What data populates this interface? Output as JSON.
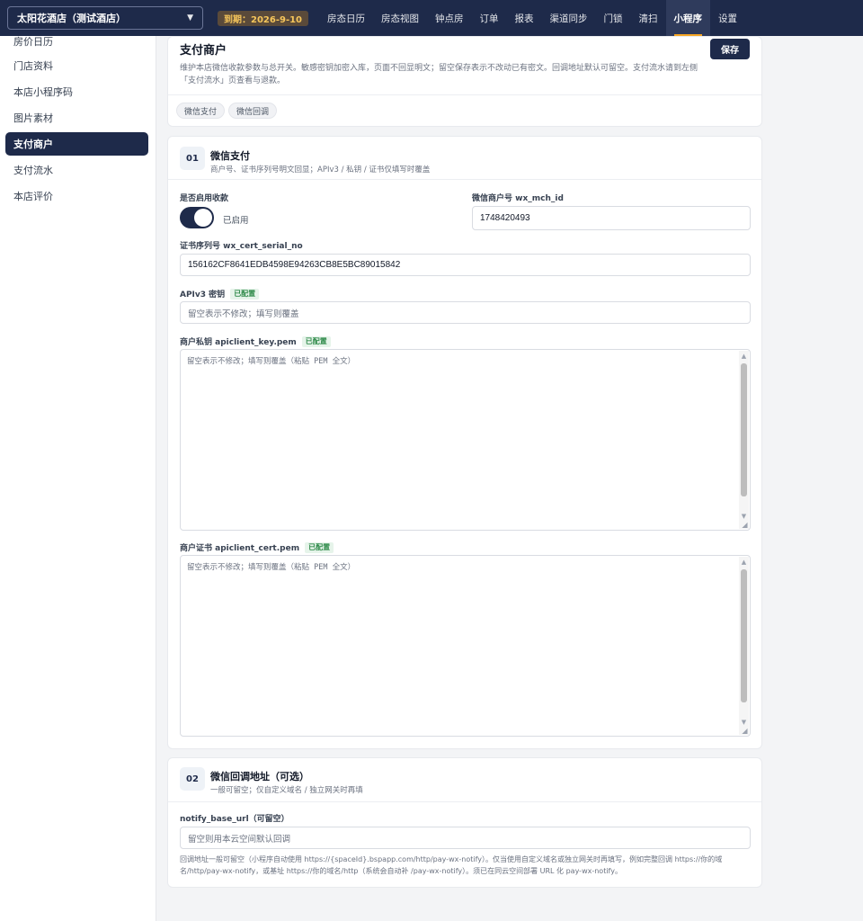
{
  "topbar": {
    "hotel_name": "太阳花酒店（测试酒店）",
    "expire": "到期：2026-9-10",
    "nav": [
      {
        "label": "房态日历"
      },
      {
        "label": "房态视图"
      },
      {
        "label": "钟点房"
      },
      {
        "label": "订单"
      },
      {
        "label": "报表"
      },
      {
        "label": "渠道同步"
      },
      {
        "label": "门锁"
      },
      {
        "label": "清扫"
      },
      {
        "label": "小程序",
        "active": true
      },
      {
        "label": "设置"
      }
    ]
  },
  "sidebar": {
    "items": [
      {
        "label": "房价日历"
      },
      {
        "label": "门店资料"
      },
      {
        "label": "本店小程序码"
      },
      {
        "label": "图片素材"
      },
      {
        "label": "支付商户",
        "active": true
      },
      {
        "label": "支付流水"
      },
      {
        "label": "本店评价"
      }
    ]
  },
  "header": {
    "title": "支付商户",
    "save_label": "保存",
    "desc": "维护本店微信收款参数与总开关。敏感密钥加密入库，页面不回显明文；留空保存表示不改动已有密文。回调地址默认可留空。支付流水请到左侧「支付流水」页查看与退款。",
    "chips": [
      "微信支付",
      "微信回调"
    ]
  },
  "wechat_pay": {
    "num": "01",
    "title": "微信支付",
    "sub": "商户号、证书序列号明文回显；APIv3 / 私钥 / 证书仅填写时覆盖",
    "enable_label": "是否启用收款",
    "enable_state": "已启用",
    "enabled": true,
    "mch_id_label": "微信商户号 wx_mch_id",
    "mch_id_value": "1748420493",
    "serial_label": "证书序列号 wx_cert_serial_no",
    "serial_value": "156162CF8641EDB4598E94263CB8E5BC89015842",
    "apiv3_label": "APIv3 密钥",
    "configured_tag": "已配置",
    "apiv3_placeholder": "留空表示不修改；填写则覆盖",
    "key_label": "商户私钥 apiclient_key.pem",
    "key_placeholder": "留空表示不修改；填写则覆盖（粘贴 PEM 全文）",
    "cert_label": "商户证书 apiclient_cert.pem",
    "cert_placeholder": "留空表示不修改；填写则覆盖（粘贴 PEM 全文）"
  },
  "callback": {
    "num": "02",
    "title": "微信回调地址（可选）",
    "sub": "一般可留空；仅自定义域名 / 独立网关时再填",
    "notify_label": "notify_base_url（可留空）",
    "notify_placeholder": "留空则用本云空间默认回调",
    "hint": "回调地址一般可留空（小程序自动使用 https://{spaceId}.bspapp.com/http/pay-wx-notify）。仅当使用自定义域名或独立网关时再填写，例如完整回调 https://你的域名/http/pay-wx-notify，或基址 https://你的域名/http（系统会自动补 /pay-wx-notify）。须已在同云空间部署 URL 化 pay-wx-notify。"
  },
  "colors": {
    "navy": "#1e2a4a",
    "accent": "#f5a524",
    "success_tag": "#2f8a4a"
  }
}
